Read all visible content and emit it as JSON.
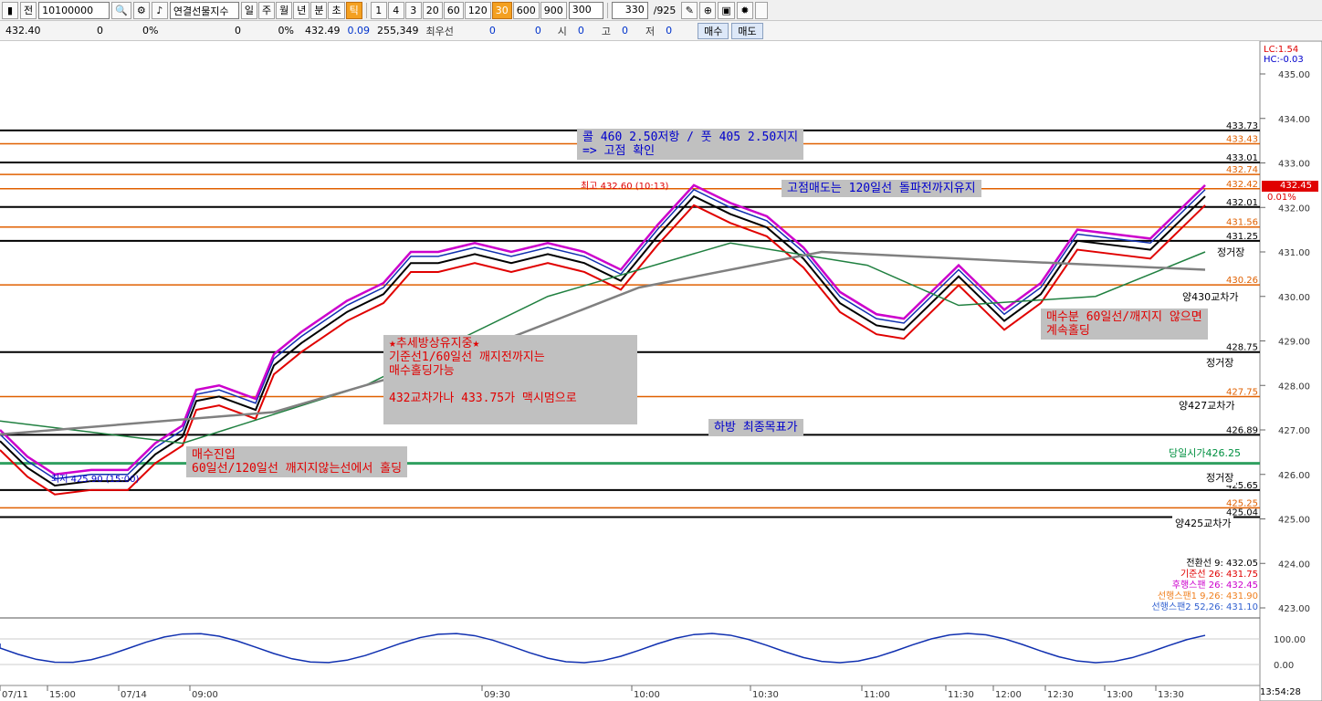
{
  "toolbar": {
    "code": "10100000",
    "label_jeon": "전",
    "search_icon": "search-icon",
    "instrument": "연결선물지수",
    "periods": [
      "일",
      "주",
      "월",
      "년",
      "분",
      "초",
      "틱"
    ],
    "active_period": "틱",
    "intervals": [
      "1",
      "4",
      "3",
      "20",
      "60",
      "120",
      "30",
      "600",
      "900"
    ],
    "active_interval": "30",
    "interval_value": "300",
    "count": "330",
    "total": "/925"
  },
  "quote": {
    "price": "432.40",
    "v1": "0",
    "v2": "0%",
    "v3": "0",
    "v4": "0%",
    "last": "432.49",
    "change": "0.09",
    "volume": "255,349",
    "best_label": "최우선",
    "best1": "0",
    "best2": "0",
    "open_label": "시",
    "open": "0",
    "high_label": "고",
    "high": "0",
    "low_label": "저",
    "low": "0",
    "buy": "매수",
    "sell": "매도"
  },
  "annotations": {
    "call_put": "콜 460 2.50저항 / 풋 405 2.50지지\n=> 고점 확인",
    "high_sell": "고점매도는 120일선 돌파전까지유지",
    "trend": "★추세방상유지중★\n기준선1/60일선 깨지전까지는\n매수홀딩가능\n\n432교차가나 433.75가 맥시멈으로",
    "buy_entry": "매수진입\n60일선/120일선 깨지지않는선에서 홀딩",
    "hold": "매수분 60일선/깨지지 않으면\n계속홀딩",
    "target": "하방 최종목표가",
    "peak": "최고 432.60 (10:13)",
    "low": "최저 425.90 (15:00)"
  },
  "right_labels": {
    "lc": "LC:1.54",
    "hc": "HC:-0.03",
    "current": "432.45",
    "current_pct": "0.01%",
    "jeonggeojang1": "정거장",
    "jeonggeojang2": "정거장",
    "jeonggeojang3": "정거장",
    "yang430": "양430교차가",
    "yang427": "양427교차가",
    "yang425": "양425교차가",
    "open_today": "당일시가426.25"
  },
  "y_axis": [
    "435.00",
    "434.00",
    "433.00",
    "432.00",
    "431.00",
    "430.00",
    "429.00",
    "428.00",
    "427.00",
    "426.00",
    "425.00",
    "424.00",
    "423.00"
  ],
  "level_labels": [
    {
      "v": "433.73",
      "c": "#000000"
    },
    {
      "v": "433.43",
      "c": "#e06000"
    },
    {
      "v": "433.01",
      "c": "#000000"
    },
    {
      "v": "432.74",
      "c": "#e06000"
    },
    {
      "v": "432.42",
      "c": "#e06000"
    },
    {
      "v": "432.01",
      "c": "#000000"
    },
    {
      "v": "431.56",
      "c": "#e06000"
    },
    {
      "v": "431.25",
      "c": "#000000"
    },
    {
      "v": "430.26",
      "c": "#e06000"
    },
    {
      "v": "428.75",
      "c": "#000000"
    },
    {
      "v": "427.75",
      "c": "#e06000"
    },
    {
      "v": "426.89",
      "c": "#000000"
    },
    {
      "v": "425.65",
      "c": "#000000"
    },
    {
      "v": "425.25",
      "c": "#e06000"
    },
    {
      "v": "425.04",
      "c": "#000000"
    }
  ],
  "legend": [
    {
      "text": "전환선 9: 432.05",
      "color": "#000000"
    },
    {
      "text": "기준선 26: 431.75",
      "color": "#e00000"
    },
    {
      "text": "후행스팬 26: 432.45",
      "color": "#cc00cc"
    },
    {
      "text": "선행스팬1 9,26: 431.90",
      "color": "#f08020"
    },
    {
      "text": "선행스팬2 52,26: 431.10",
      "color": "#3060d0"
    }
  ],
  "osc_axis": [
    "100.00",
    "0.00"
  ],
  "x_axis": [
    "07/11",
    "15:00",
    "07/14",
    "09:00",
    "09:30",
    "10:00",
    "10:30",
    "11:00",
    "11:30",
    "12:00",
    "12:30",
    "13:00",
    "13:30"
  ],
  "clock": "13:54:28"
}
